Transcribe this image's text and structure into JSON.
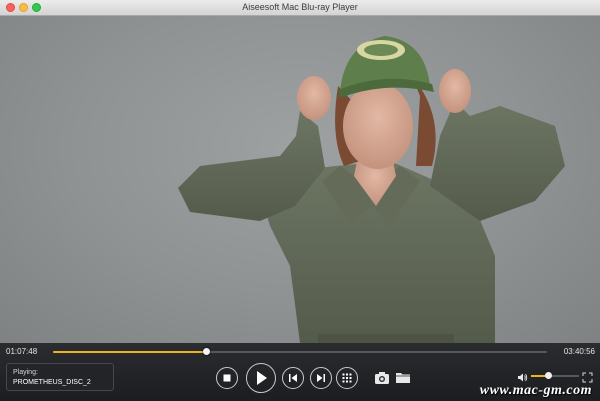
{
  "window": {
    "title": "Aiseesoft Mac Blu-ray Player"
  },
  "playback": {
    "current_time": "01:07:48",
    "total_time": "03:40:56",
    "progress_fraction": 0.31,
    "volume_fraction": 0.35
  },
  "now_playing": {
    "label": "Playing:",
    "title": "PROMETHEUS_DISC_2"
  },
  "controls": {
    "stop_icon": "stop-icon",
    "play_icon": "play-icon",
    "previous_icon": "previous-icon",
    "next_icon": "next-icon",
    "menu_icon": "grid-menu-icon",
    "snapshot_icon": "camera-icon",
    "folder_icon": "folder-icon",
    "volume_icon": "speaker-icon",
    "fullscreen_icon": "expand-icon"
  },
  "colors": {
    "accent": "#f0b31d",
    "controlbar": "#1f2023"
  },
  "watermark": {
    "text": "www.mac-gm.com"
  }
}
